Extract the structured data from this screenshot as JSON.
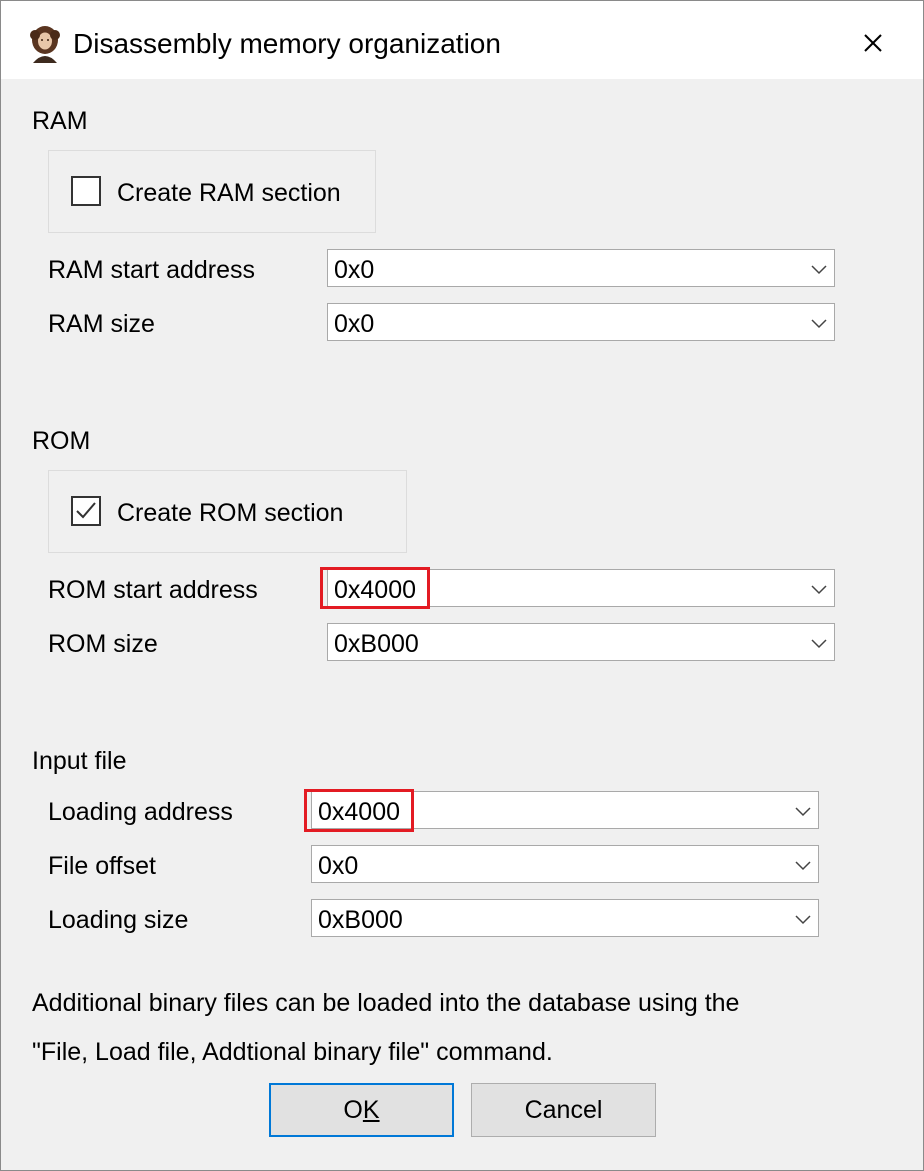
{
  "window": {
    "title": "Disassembly memory organization"
  },
  "ram": {
    "section_label": "RAM",
    "create_label": "Create RAM section",
    "create_checked": false,
    "start_label": "RAM start address",
    "start_value": "0x0",
    "size_label": "RAM size",
    "size_value": "0x0"
  },
  "rom": {
    "section_label": "ROM",
    "create_label": "Create ROM section",
    "create_checked": true,
    "start_label": "ROM start address",
    "start_value": "0x4000",
    "size_label": "ROM size",
    "size_value": "0xB000"
  },
  "input_file": {
    "section_label": "Input file",
    "loading_address_label": "Loading address",
    "loading_address_value": "0x4000",
    "file_offset_label": "File offset",
    "file_offset_value": "0x0",
    "loading_size_label": "Loading size",
    "loading_size_value": "0xB000"
  },
  "note": {
    "line1": "Additional binary files can be loaded into the database using the",
    "line2": "\"File, Load file, Addtional binary file\" command."
  },
  "buttons": {
    "ok_label_prefix": "O",
    "ok_label_mnemonic": "K",
    "cancel_label": "Cancel"
  },
  "colors": {
    "highlight": "#e31b23",
    "default_button_border": "#0078d7"
  }
}
